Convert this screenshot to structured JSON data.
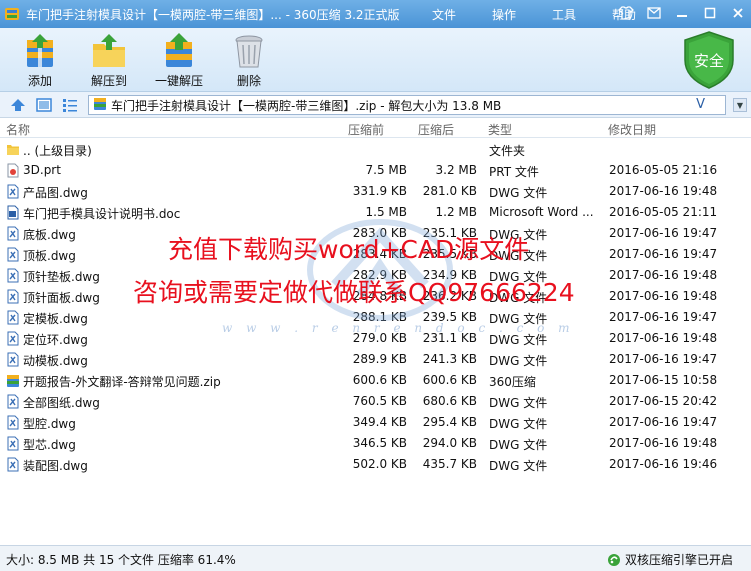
{
  "window": {
    "title": "车门把手注射模具设计【一模两腔-带三维图】... - 360压缩 3.2正式版",
    "menu": [
      "文件",
      "操作",
      "工具",
      "帮助"
    ]
  },
  "toolbar": {
    "add_label": "添加",
    "extract_label": "解压到",
    "one_click_label": "一键解压",
    "delete_label": "删除",
    "security_label": "安全"
  },
  "address": {
    "path": "车门把手注射模具设计【一模两腔-带三维图】.zip - 解包大小为 13.8 MB",
    "dropdown_glyph": "V"
  },
  "columns": {
    "name": "名称",
    "size": "压缩前",
    "packed": "压缩后",
    "type": "类型",
    "modified": "修改日期"
  },
  "files": [
    {
      "name": ".. (上级目录)",
      "size": "",
      "packed": "",
      "type": "文件夹",
      "modified": "",
      "icon": "folder-icon"
    },
    {
      "name": "3D.prt",
      "size": "7.5 MB",
      "packed": "3.2 MB",
      "type": "PRT 文件",
      "modified": "2016-05-05 21:16",
      "icon": "prt-file-icon"
    },
    {
      "name": "产品图.dwg",
      "size": "331.9 KB",
      "packed": "281.0 KB",
      "type": "DWG 文件",
      "modified": "2017-06-16 19:48",
      "icon": "dwg-file-icon"
    },
    {
      "name": "车门把手模具设计说明书.doc",
      "size": "1.5 MB",
      "packed": "1.2 MB",
      "type": "Microsoft Word ...",
      "modified": "2016-05-05 21:11",
      "icon": "doc-file-icon"
    },
    {
      "name": "底板.dwg",
      "size": "283.0 KB",
      "packed": "235.1 KB",
      "type": "DWG 文件",
      "modified": "2017-06-16 19:47",
      "icon": "dwg-file-icon"
    },
    {
      "name": "顶板.dwg",
      "size": "283.4 KB",
      "packed": "235.5 KB",
      "type": "DWG 文件",
      "modified": "2017-06-16 19:47",
      "icon": "dwg-file-icon"
    },
    {
      "name": "顶针垫板.dwg",
      "size": "282.9 KB",
      "packed": "234.9 KB",
      "type": "DWG 文件",
      "modified": "2017-06-16 19:48",
      "icon": "dwg-file-icon"
    },
    {
      "name": "顶针面板.dwg",
      "size": "284.8 KB",
      "packed": "236.2 KB",
      "type": "DWG 文件",
      "modified": "2017-06-16 19:48",
      "icon": "dwg-file-icon"
    },
    {
      "name": "定模板.dwg",
      "size": "288.1 KB",
      "packed": "239.5 KB",
      "type": "DWG 文件",
      "modified": "2017-06-16 19:47",
      "icon": "dwg-file-icon"
    },
    {
      "name": "定位环.dwg",
      "size": "279.0 KB",
      "packed": "231.1 KB",
      "type": "DWG 文件",
      "modified": "2017-06-16 19:48",
      "icon": "dwg-file-icon"
    },
    {
      "name": "动模板.dwg",
      "size": "289.9 KB",
      "packed": "241.3 KB",
      "type": "DWG 文件",
      "modified": "2017-06-16 19:47",
      "icon": "dwg-file-icon"
    },
    {
      "name": "开题报告-外文翻译-答辩常见问题.zip",
      "size": "600.6 KB",
      "packed": "600.6 KB",
      "type": "360压缩",
      "modified": "2017-06-15 10:58",
      "icon": "zip-file-icon"
    },
    {
      "name": "全部图纸.dwg",
      "size": "760.5 KB",
      "packed": "680.6 KB",
      "type": "DWG 文件",
      "modified": "2017-06-15 20:42",
      "icon": "dwg-file-icon"
    },
    {
      "name": "型腔.dwg",
      "size": "349.4 KB",
      "packed": "295.4 KB",
      "type": "DWG 文件",
      "modified": "2017-06-16 19:47",
      "icon": "dwg-file-icon"
    },
    {
      "name": "型芯.dwg",
      "size": "346.5 KB",
      "packed": "294.0 KB",
      "type": "DWG 文件",
      "modified": "2017-06-16 19:48",
      "icon": "dwg-file-icon"
    },
    {
      "name": "装配图.dwg",
      "size": "502.0 KB",
      "packed": "435.7 KB",
      "type": "DWG 文件",
      "modified": "2017-06-16 19:46",
      "icon": "dwg-file-icon"
    }
  ],
  "overlay": {
    "promo_line1": "充值下载购买word+CAD源文件",
    "promo_line2": "咨询或需要定做代做联系QQ97666224",
    "watermark_site": "w w w . r e n r e n d o c . c o m"
  },
  "status": {
    "summary": "大小: 8.5 MB 共 15 个文件 压缩率 61.4%",
    "engine": "双核压缩引擎已开启"
  },
  "colors": {
    "titlebar": "#4a93d6",
    "promo": "#e8101e",
    "security_green": "#3aa33a"
  }
}
